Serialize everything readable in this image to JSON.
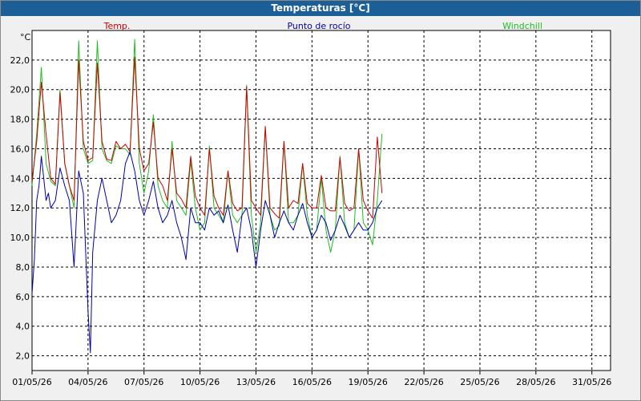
{
  "window": {
    "title": "Temperaturas [°C]"
  },
  "colors": {
    "titlebar": "#1c5f96",
    "plot_bg": "#ffffff",
    "grid": "#000000"
  },
  "chart_data": {
    "type": "line",
    "title": "Temperaturas [°C]",
    "y_unit_label": "°C",
    "grid": true,
    "legend_placement": "top",
    "x_range": [
      "01/05/26",
      "01/06/26"
    ],
    "ylim": [
      1.0,
      24.0
    ],
    "x_tick_labels": [
      "01/05/26",
      "04/05/26",
      "07/05/26",
      "10/05/26",
      "13/05/26",
      "16/05/26",
      "19/05/26",
      "22/05/26",
      "25/05/26",
      "28/05/26",
      "31/05/26"
    ],
    "y_tick_labels": [
      "2,0",
      "4,0",
      "6,0",
      "8,0",
      "10,0",
      "12,0",
      "14,0",
      "16,0",
      "18,0",
      "20,0",
      "22,0"
    ],
    "y_ticks": [
      2,
      4,
      6,
      8,
      10,
      12,
      14,
      16,
      18,
      20,
      22
    ],
    "series": [
      {
        "name": "Temp.",
        "color": "#cc0000",
        "points": [
          [
            "01/05 00:00",
            13.8
          ],
          [
            "01/05 06:00",
            16.5
          ],
          [
            "01/05 12:00",
            20.5
          ],
          [
            "01/05 18:00",
            17.0
          ],
          [
            "02/05 00:00",
            14.0
          ],
          [
            "02/05 06:00",
            13.6
          ],
          [
            "02/05 12:00",
            19.8
          ],
          [
            "02/05 18:00",
            15.0
          ],
          [
            "03/05 00:00",
            13.5
          ],
          [
            "03/05 06:00",
            12.5
          ],
          [
            "03/05 12:00",
            22.0
          ],
          [
            "03/05 18:00",
            16.5
          ],
          [
            "04/05 00:00",
            15.2
          ],
          [
            "04/05 06:00",
            15.4
          ],
          [
            "04/05 12:00",
            21.8
          ],
          [
            "04/05 18:00",
            16.5
          ],
          [
            "05/05 00:00",
            15.3
          ],
          [
            "05/05 06:00",
            15.2
          ],
          [
            "05/05 12:00",
            16.5
          ],
          [
            "05/05 18:00",
            16.0
          ],
          [
            "06/05 00:00",
            16.3
          ],
          [
            "06/05 06:00",
            15.8
          ],
          [
            "06/05 12:00",
            22.2
          ],
          [
            "06/05 18:00",
            16.0
          ],
          [
            "07/05 00:00",
            14.5
          ],
          [
            "07/05 06:00",
            15.0
          ],
          [
            "07/05 12:00",
            17.8
          ],
          [
            "07/05 18:00",
            14.0
          ],
          [
            "08/05 00:00",
            13.5
          ],
          [
            "08/05 06:00",
            12.5
          ],
          [
            "08/05 12:00",
            16.0
          ],
          [
            "08/05 18:00",
            13.0
          ],
          [
            "09/05 00:00",
            12.6
          ],
          [
            "09/05 06:00",
            12.0
          ],
          [
            "09/05 12:00",
            15.5
          ],
          [
            "09/05 18:00",
            12.8
          ],
          [
            "10/05 00:00",
            12.0
          ],
          [
            "10/05 06:00",
            11.5
          ],
          [
            "10/05 12:00",
            16.0
          ],
          [
            "10/05 18:00",
            12.8
          ],
          [
            "11/05 00:00",
            12.0
          ],
          [
            "11/05 06:00",
            11.5
          ],
          [
            "11/05 12:00",
            14.5
          ],
          [
            "11/05 18:00",
            12.3
          ],
          [
            "12/05 00:00",
            11.8
          ],
          [
            "12/05 06:00",
            12.0
          ],
          [
            "12/05 12:00",
            20.2
          ],
          [
            "12/05 18:00",
            12.5
          ],
          [
            "13/05 00:00",
            12.0
          ],
          [
            "13/05 06:00",
            11.5
          ],
          [
            "13/05 12:00",
            17.5
          ],
          [
            "13/05 18:00",
            12.0
          ],
          [
            "14/05 00:00",
            11.6
          ],
          [
            "14/05 06:00",
            11.3
          ],
          [
            "14/05 12:00",
            16.5
          ],
          [
            "14/05 18:00",
            12.0
          ],
          [
            "15/05 00:00",
            12.5
          ],
          [
            "15/05 06:00",
            12.3
          ],
          [
            "15/05 12:00",
            15.0
          ],
          [
            "15/05 18:00",
            12.3
          ],
          [
            "16/05 00:00",
            12.0
          ],
          [
            "16/05 06:00",
            12.0
          ],
          [
            "16/05 12:00",
            14.2
          ],
          [
            "16/05 18:00",
            12.0
          ],
          [
            "17/05 00:00",
            11.8
          ],
          [
            "17/05 06:00",
            11.8
          ],
          [
            "17/05 12:00",
            15.4
          ],
          [
            "17/05 18:00",
            12.3
          ],
          [
            "18/05 00:00",
            11.8
          ],
          [
            "18/05 06:00",
            12.0
          ],
          [
            "18/05 12:00",
            16.0
          ],
          [
            "18/05 18:00",
            12.5
          ],
          [
            "19/05 00:00",
            11.8
          ],
          [
            "19/05 06:00",
            11.3
          ],
          [
            "19/05 12:00",
            16.8
          ],
          [
            "19/05 18:00",
            13.0
          ]
        ]
      },
      {
        "name": "Punto de rocío",
        "color": "#0000aa",
        "points": [
          [
            "01/05 00:00",
            6.2
          ],
          [
            "01/05 03:00",
            8.5
          ],
          [
            "01/05 06:00",
            12.5
          ],
          [
            "01/05 09:00",
            13.5
          ],
          [
            "01/05 12:00",
            15.5
          ],
          [
            "01/05 15:00",
            14.0
          ],
          [
            "01/05 18:00",
            12.5
          ],
          [
            "01/05 21:00",
            13.0
          ],
          [
            "02/05 00:00",
            12.0
          ],
          [
            "02/05 06:00",
            12.5
          ],
          [
            "02/05 12:00",
            14.7
          ],
          [
            "02/05 18:00",
            13.5
          ],
          [
            "03/05 00:00",
            12.5
          ],
          [
            "03/05 06:00",
            8.0
          ],
          [
            "03/05 12:00",
            14.5
          ],
          [
            "03/05 18:00",
            13.0
          ],
          [
            "04/05 00:00",
            5.0
          ],
          [
            "04/05 03:00",
            2.2
          ],
          [
            "04/05 06:00",
            9.0
          ],
          [
            "04/05 12:00",
            12.5
          ],
          [
            "04/05 18:00",
            14.0
          ],
          [
            "05/05 00:00",
            12.5
          ],
          [
            "05/05 06:00",
            11.0
          ],
          [
            "05/05 12:00",
            11.5
          ],
          [
            "05/05 18:00",
            12.5
          ],
          [
            "06/05 00:00",
            15.0
          ],
          [
            "06/05 06:00",
            15.8
          ],
          [
            "06/05 12:00",
            14.5
          ],
          [
            "06/05 18:00",
            12.5
          ],
          [
            "07/05 00:00",
            11.5
          ],
          [
            "07/05 06:00",
            12.5
          ],
          [
            "07/05 12:00",
            13.8
          ],
          [
            "07/05 18:00",
            12.0
          ],
          [
            "08/05 00:00",
            11.0
          ],
          [
            "08/05 06:00",
            11.5
          ],
          [
            "08/05 12:00",
            12.5
          ],
          [
            "08/05 18:00",
            11.0
          ],
          [
            "09/05 00:00",
            10.0
          ],
          [
            "09/05 06:00",
            8.5
          ],
          [
            "09/05 12:00",
            12.0
          ],
          [
            "09/05 18:00",
            11.0
          ],
          [
            "10/05 00:00",
            11.0
          ],
          [
            "10/05 06:00",
            10.5
          ],
          [
            "10/05 12:00",
            12.0
          ],
          [
            "10/05 18:00",
            11.5
          ],
          [
            "11/05 00:00",
            11.8
          ],
          [
            "11/05 06:00",
            11.0
          ],
          [
            "11/05 12:00",
            12.2
          ],
          [
            "11/05 18:00",
            10.5
          ],
          [
            "12/05 00:00",
            9.0
          ],
          [
            "12/05 06:00",
            11.5
          ],
          [
            "12/05 12:00",
            12.0
          ],
          [
            "12/05 18:00",
            10.5
          ],
          [
            "13/05 00:00",
            8.0
          ],
          [
            "13/05 06:00",
            10.5
          ],
          [
            "13/05 12:00",
            12.5
          ],
          [
            "13/05 18:00",
            11.5
          ],
          [
            "14/05 00:00",
            10.0
          ],
          [
            "14/05 06:00",
            11.0
          ],
          [
            "14/05 12:00",
            11.8
          ],
          [
            "14/05 18:00",
            11.0
          ],
          [
            "15/05 00:00",
            10.5
          ],
          [
            "15/05 06:00",
            11.5
          ],
          [
            "15/05 12:00",
            12.3
          ],
          [
            "15/05 18:00",
            11.0
          ],
          [
            "16/05 00:00",
            10.0
          ],
          [
            "16/05 06:00",
            10.5
          ],
          [
            "16/05 12:00",
            11.5
          ],
          [
            "16/05 18:00",
            11.0
          ],
          [
            "17/05 00:00",
            9.8
          ],
          [
            "17/05 06:00",
            10.5
          ],
          [
            "17/05 12:00",
            11.5
          ],
          [
            "17/05 18:00",
            10.8
          ],
          [
            "18/05 00:00",
            10.0
          ],
          [
            "18/05 06:00",
            10.5
          ],
          [
            "18/05 12:00",
            11.0
          ],
          [
            "18/05 18:00",
            10.5
          ],
          [
            "19/05 00:00",
            10.5
          ],
          [
            "19/05 06:00",
            11.0
          ],
          [
            "19/05 12:00",
            12.0
          ],
          [
            "19/05 18:00",
            12.5
          ]
        ]
      },
      {
        "name": "Windchill",
        "color": "#22bb22",
        "points": [
          [
            "01/05 00:00",
            13.5
          ],
          [
            "01/05 06:00",
            17.0
          ],
          [
            "01/05 12:00",
            21.5
          ],
          [
            "01/05 18:00",
            15.0
          ],
          [
            "02/05 00:00",
            13.8
          ],
          [
            "02/05 06:00",
            13.5
          ],
          [
            "02/05 12:00",
            20.0
          ],
          [
            "02/05 18:00",
            15.0
          ],
          [
            "03/05 00:00",
            13.5
          ],
          [
            "03/05 06:00",
            12.0
          ],
          [
            "03/05 12:00",
            23.3
          ],
          [
            "03/05 18:00",
            16.0
          ],
          [
            "04/05 00:00",
            15.0
          ],
          [
            "04/05 06:00",
            15.2
          ],
          [
            "04/05 12:00",
            23.3
          ],
          [
            "04/05 18:00",
            16.0
          ],
          [
            "05/05 00:00",
            15.2
          ],
          [
            "05/05 06:00",
            15.0
          ],
          [
            "05/05 12:00",
            16.2
          ],
          [
            "05/05 18:00",
            16.0
          ],
          [
            "06/05 00:00",
            16.0
          ],
          [
            "06/05 06:00",
            15.6
          ],
          [
            "06/05 12:00",
            23.4
          ],
          [
            "06/05 18:00",
            15.0
          ],
          [
            "07/05 00:00",
            13.0
          ],
          [
            "07/05 06:00",
            14.5
          ],
          [
            "07/05 12:00",
            18.3
          ],
          [
            "07/05 18:00",
            13.5
          ],
          [
            "08/05 00:00",
            12.5
          ],
          [
            "08/05 06:00",
            12.0
          ],
          [
            "08/05 12:00",
            16.5
          ],
          [
            "08/05 18:00",
            12.5
          ],
          [
            "09/05 00:00",
            12.0
          ],
          [
            "09/05 06:00",
            11.5
          ],
          [
            "09/05 12:00",
            15.2
          ],
          [
            "09/05 18:00",
            12.0
          ],
          [
            "10/05 00:00",
            10.5
          ],
          [
            "10/05 06:00",
            11.0
          ],
          [
            "10/05 12:00",
            16.2
          ],
          [
            "10/05 18:00",
            12.0
          ],
          [
            "11/05 00:00",
            11.5
          ],
          [
            "11/05 06:00",
            11.0
          ],
          [
            "11/05 12:00",
            14.5
          ],
          [
            "11/05 18:00",
            11.5
          ],
          [
            "12/05 00:00",
            11.0
          ],
          [
            "12/05 06:00",
            11.5
          ],
          [
            "12/05 12:00",
            20.3
          ],
          [
            "12/05 18:00",
            11.5
          ],
          [
            "13/05 00:00",
            9.0
          ],
          [
            "13/05 06:00",
            11.0
          ],
          [
            "13/05 12:00",
            17.5
          ],
          [
            "13/05 18:00",
            11.5
          ],
          [
            "14/05 00:00",
            10.5
          ],
          [
            "14/05 06:00",
            10.8
          ],
          [
            "14/05 12:00",
            16.5
          ],
          [
            "14/05 18:00",
            11.0
          ],
          [
            "15/05 00:00",
            11.0
          ],
          [
            "15/05 06:00",
            11.5
          ],
          [
            "15/05 12:00",
            15.0
          ],
          [
            "15/05 18:00",
            11.5
          ],
          [
            "16/05 00:00",
            10.0
          ],
          [
            "16/05 06:00",
            10.5
          ],
          [
            "16/05 12:00",
            14.0
          ],
          [
            "16/05 18:00",
            10.5
          ],
          [
            "17/05 00:00",
            9.0
          ],
          [
            "17/05 06:00",
            10.5
          ],
          [
            "17/05 12:00",
            15.5
          ],
          [
            "17/05 18:00",
            11.0
          ],
          [
            "18/05 00:00",
            10.0
          ],
          [
            "18/05 06:00",
            10.5
          ],
          [
            "18/05 12:00",
            16.0
          ],
          [
            "18/05 18:00",
            11.0
          ],
          [
            "19/05 00:00",
            10.5
          ],
          [
            "19/05 06:00",
            9.5
          ],
          [
            "19/05 12:00",
            12.5
          ],
          [
            "19/05 18:00",
            17.0
          ]
        ]
      }
    ]
  }
}
